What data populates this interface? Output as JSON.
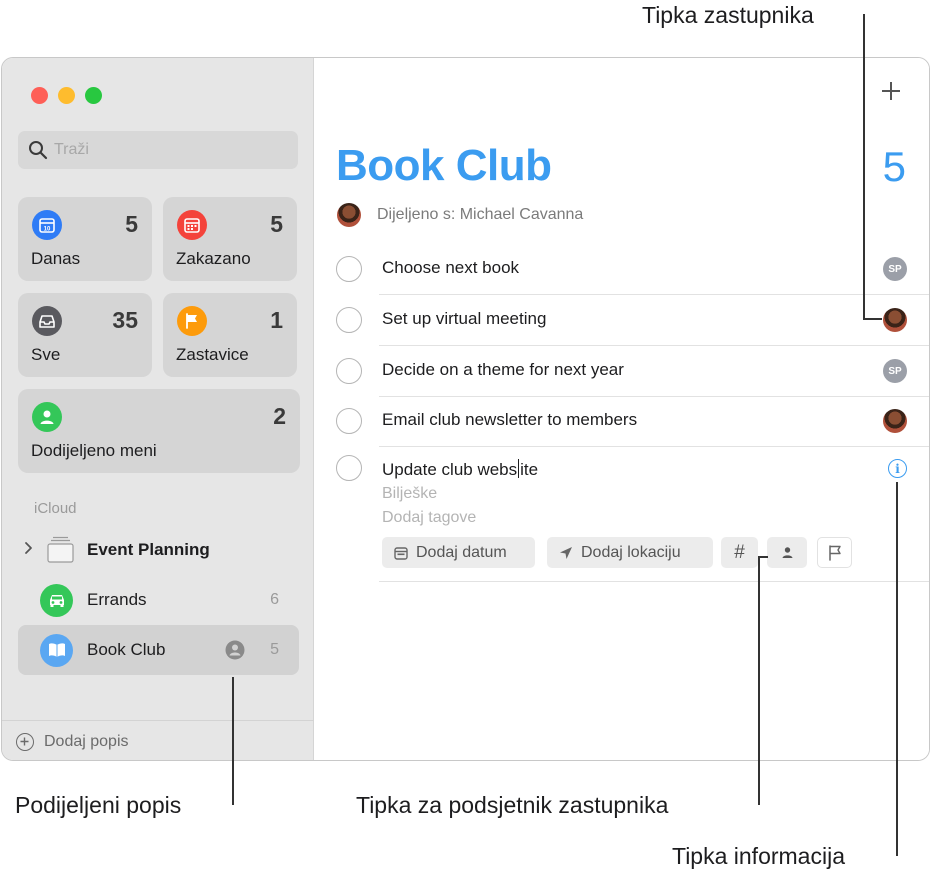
{
  "sidebar": {
    "search_placeholder": "Traži",
    "tiles": [
      {
        "label": "Danas",
        "count": "5",
        "icon": "calendar-today-icon",
        "color": "#2f7cf6"
      },
      {
        "label": "Zakazano",
        "count": "5",
        "icon": "calendar-scheduled-icon",
        "color": "#f4433b"
      },
      {
        "label": "Sve",
        "count": "35",
        "icon": "tray-icon",
        "color": "#5a5a5f"
      },
      {
        "label": "Zastavice",
        "count": "1",
        "icon": "flag-icon",
        "color": "#fd9b0b"
      },
      {
        "label": "Dodijeljeno meni",
        "count": "2",
        "icon": "person-icon",
        "color": "#34c759"
      }
    ],
    "section": "iCloud",
    "lists": [
      {
        "name": "Event Planning",
        "count": "",
        "icon": "folder-group-icon"
      },
      {
        "name": "Errands",
        "count": "6",
        "icon": "car-icon",
        "color": "#34c759"
      },
      {
        "name": "Book Club",
        "count": "5",
        "icon": "book-icon",
        "color": "#5aa7f2"
      }
    ],
    "footer_label": "Dodaj popis"
  },
  "main": {
    "title": "Book Club",
    "count": "5",
    "shared_with": "Dijeljeno s: Michael Cavanna",
    "reminders": [
      {
        "text": "Choose next book",
        "assignee": "SP"
      },
      {
        "text": "Set up virtual meeting",
        "assignee": "photo"
      },
      {
        "text": "Decide on a theme for next year",
        "assignee": "SP"
      },
      {
        "text": "Email club newsletter to members",
        "assignee": "photo"
      }
    ],
    "editing": {
      "text_before_cursor": "Update club webs",
      "text_after_cursor": "ite",
      "notes_placeholder": "Bilješke",
      "tags_placeholder": "Dodaj tagove",
      "add_date": "Dodaj datum",
      "add_location": "Dodaj lokaciju",
      "tag_symbol": "#"
    }
  },
  "callouts": {
    "assignee_button": "Tipka zastupnika",
    "shared_list": "Podijeljeni popis",
    "assign_reminder_button": "Tipka za podsjetnik zastupnika",
    "info_button": "Tipka informacija"
  }
}
